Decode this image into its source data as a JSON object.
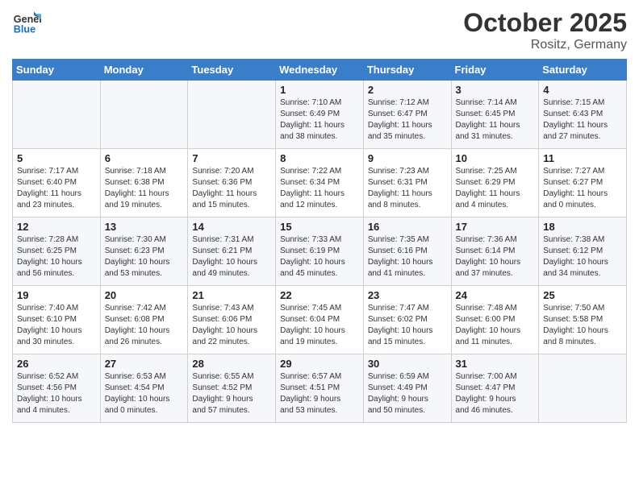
{
  "header": {
    "logo_general": "General",
    "logo_blue": "Blue",
    "month_title": "October 2025",
    "subtitle": "Rositz, Germany"
  },
  "days_of_week": [
    "Sunday",
    "Monday",
    "Tuesday",
    "Wednesday",
    "Thursday",
    "Friday",
    "Saturday"
  ],
  "weeks": [
    [
      {
        "day": "",
        "info": ""
      },
      {
        "day": "",
        "info": ""
      },
      {
        "day": "",
        "info": ""
      },
      {
        "day": "1",
        "info": "Sunrise: 7:10 AM\nSunset: 6:49 PM\nDaylight: 11 hours\nand 38 minutes."
      },
      {
        "day": "2",
        "info": "Sunrise: 7:12 AM\nSunset: 6:47 PM\nDaylight: 11 hours\nand 35 minutes."
      },
      {
        "day": "3",
        "info": "Sunrise: 7:14 AM\nSunset: 6:45 PM\nDaylight: 11 hours\nand 31 minutes."
      },
      {
        "day": "4",
        "info": "Sunrise: 7:15 AM\nSunset: 6:43 PM\nDaylight: 11 hours\nand 27 minutes."
      }
    ],
    [
      {
        "day": "5",
        "info": "Sunrise: 7:17 AM\nSunset: 6:40 PM\nDaylight: 11 hours\nand 23 minutes."
      },
      {
        "day": "6",
        "info": "Sunrise: 7:18 AM\nSunset: 6:38 PM\nDaylight: 11 hours\nand 19 minutes."
      },
      {
        "day": "7",
        "info": "Sunrise: 7:20 AM\nSunset: 6:36 PM\nDaylight: 11 hours\nand 15 minutes."
      },
      {
        "day": "8",
        "info": "Sunrise: 7:22 AM\nSunset: 6:34 PM\nDaylight: 11 hours\nand 12 minutes."
      },
      {
        "day": "9",
        "info": "Sunrise: 7:23 AM\nSunset: 6:31 PM\nDaylight: 11 hours\nand 8 minutes."
      },
      {
        "day": "10",
        "info": "Sunrise: 7:25 AM\nSunset: 6:29 PM\nDaylight: 11 hours\nand 4 minutes."
      },
      {
        "day": "11",
        "info": "Sunrise: 7:27 AM\nSunset: 6:27 PM\nDaylight: 11 hours\nand 0 minutes."
      }
    ],
    [
      {
        "day": "12",
        "info": "Sunrise: 7:28 AM\nSunset: 6:25 PM\nDaylight: 10 hours\nand 56 minutes."
      },
      {
        "day": "13",
        "info": "Sunrise: 7:30 AM\nSunset: 6:23 PM\nDaylight: 10 hours\nand 53 minutes."
      },
      {
        "day": "14",
        "info": "Sunrise: 7:31 AM\nSunset: 6:21 PM\nDaylight: 10 hours\nand 49 minutes."
      },
      {
        "day": "15",
        "info": "Sunrise: 7:33 AM\nSunset: 6:19 PM\nDaylight: 10 hours\nand 45 minutes."
      },
      {
        "day": "16",
        "info": "Sunrise: 7:35 AM\nSunset: 6:16 PM\nDaylight: 10 hours\nand 41 minutes."
      },
      {
        "day": "17",
        "info": "Sunrise: 7:36 AM\nSunset: 6:14 PM\nDaylight: 10 hours\nand 37 minutes."
      },
      {
        "day": "18",
        "info": "Sunrise: 7:38 AM\nSunset: 6:12 PM\nDaylight: 10 hours\nand 34 minutes."
      }
    ],
    [
      {
        "day": "19",
        "info": "Sunrise: 7:40 AM\nSunset: 6:10 PM\nDaylight: 10 hours\nand 30 minutes."
      },
      {
        "day": "20",
        "info": "Sunrise: 7:42 AM\nSunset: 6:08 PM\nDaylight: 10 hours\nand 26 minutes."
      },
      {
        "day": "21",
        "info": "Sunrise: 7:43 AM\nSunset: 6:06 PM\nDaylight: 10 hours\nand 22 minutes."
      },
      {
        "day": "22",
        "info": "Sunrise: 7:45 AM\nSunset: 6:04 PM\nDaylight: 10 hours\nand 19 minutes."
      },
      {
        "day": "23",
        "info": "Sunrise: 7:47 AM\nSunset: 6:02 PM\nDaylight: 10 hours\nand 15 minutes."
      },
      {
        "day": "24",
        "info": "Sunrise: 7:48 AM\nSunset: 6:00 PM\nDaylight: 10 hours\nand 11 minutes."
      },
      {
        "day": "25",
        "info": "Sunrise: 7:50 AM\nSunset: 5:58 PM\nDaylight: 10 hours\nand 8 minutes."
      }
    ],
    [
      {
        "day": "26",
        "info": "Sunrise: 6:52 AM\nSunset: 4:56 PM\nDaylight: 10 hours\nand 4 minutes."
      },
      {
        "day": "27",
        "info": "Sunrise: 6:53 AM\nSunset: 4:54 PM\nDaylight: 10 hours\nand 0 minutes."
      },
      {
        "day": "28",
        "info": "Sunrise: 6:55 AM\nSunset: 4:52 PM\nDaylight: 9 hours\nand 57 minutes."
      },
      {
        "day": "29",
        "info": "Sunrise: 6:57 AM\nSunset: 4:51 PM\nDaylight: 9 hours\nand 53 minutes."
      },
      {
        "day": "30",
        "info": "Sunrise: 6:59 AM\nSunset: 4:49 PM\nDaylight: 9 hours\nand 50 minutes."
      },
      {
        "day": "31",
        "info": "Sunrise: 7:00 AM\nSunset: 4:47 PM\nDaylight: 9 hours\nand 46 minutes."
      },
      {
        "day": "",
        "info": ""
      }
    ]
  ]
}
